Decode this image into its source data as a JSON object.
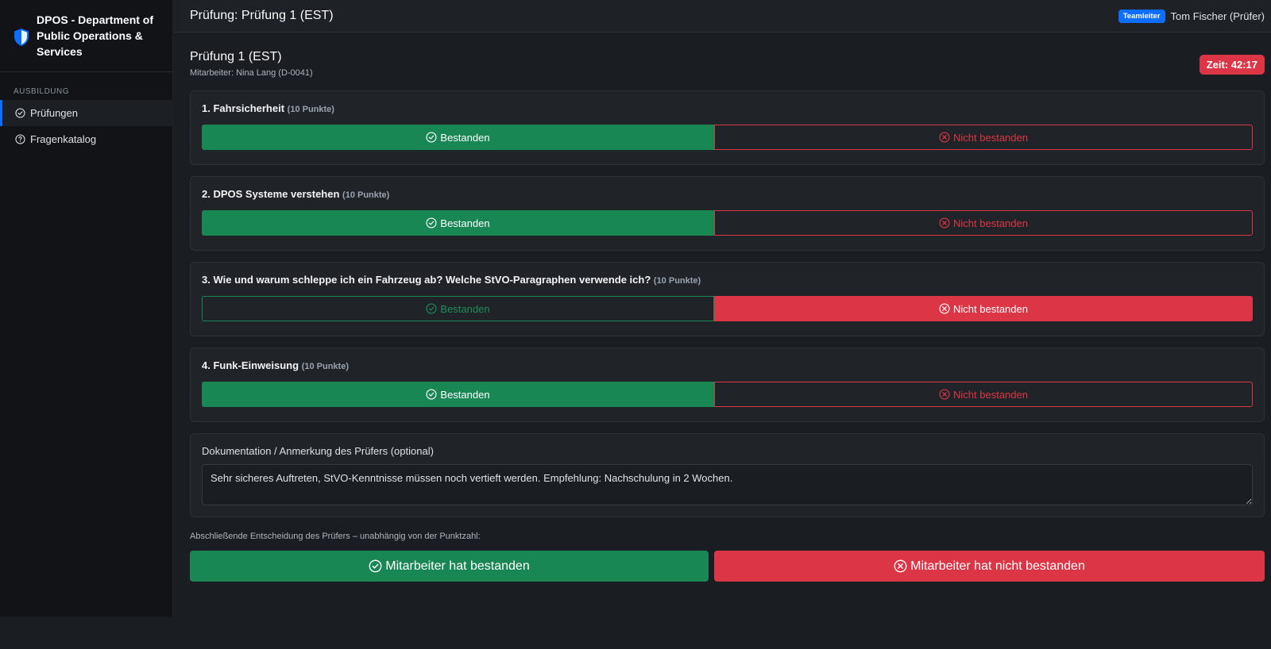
{
  "sidebar": {
    "brand": "DPOS - Department of Public Operations & Services",
    "section": "AUSBILDUNG",
    "items": [
      {
        "label": "Prüfungen",
        "icon": "check-circle-icon",
        "active": true
      },
      {
        "label": "Fragenkatalog",
        "icon": "question-circle-icon",
        "active": false
      }
    ]
  },
  "topbar": {
    "title": "Prüfung: Prüfung 1 (EST)",
    "role_badge": "Teamleiter",
    "user": "Tom Fischer (Prüfer)"
  },
  "exam": {
    "title": "Prüfung 1 (EST)",
    "employee": "Mitarbeiter: Nina Lang (D-0041)",
    "timer": "Zeit: 42:17"
  },
  "questions": [
    {
      "title": "1. Fahrsicherheit",
      "points": "(10 Punkte)",
      "pass_label": "Bestanden",
      "fail_label": "Nicht bestanden",
      "selected": "pass"
    },
    {
      "title": "2. DPOS Systeme verstehen",
      "points": "(10 Punkte)",
      "pass_label": "Bestanden",
      "fail_label": "Nicht bestanden",
      "selected": "pass"
    },
    {
      "title": "3. Wie und warum schleppe ich ein Fahrzeug ab? Welche StVO-Paragraphen verwende ich?",
      "points": "(10 Punkte)",
      "pass_label": "Bestanden",
      "fail_label": "Nicht bestanden",
      "selected": "fail"
    },
    {
      "title": "4. Funk-Einweisung",
      "points": "(10 Punkte)",
      "pass_label": "Bestanden",
      "fail_label": "Nicht bestanden",
      "selected": "pass"
    }
  ],
  "documentation": {
    "label": "Dokumentation / Anmerkung des Prüfers (optional)",
    "value": "Sehr sicheres Auftreten, StVO-Kenntnisse müssen noch vertieft werden. Empfehlung: Nachschulung in 2 Wochen."
  },
  "final": {
    "label": "Abschließende Entscheidung des Prüfers – unabhängig von der Punktzahl:",
    "pass_button": "Mitarbeiter hat bestanden",
    "fail_button": "Mitarbeiter hat nicht bestanden"
  },
  "colors": {
    "success": "#198754",
    "danger": "#dc3545",
    "primary": "#0d6efd"
  }
}
